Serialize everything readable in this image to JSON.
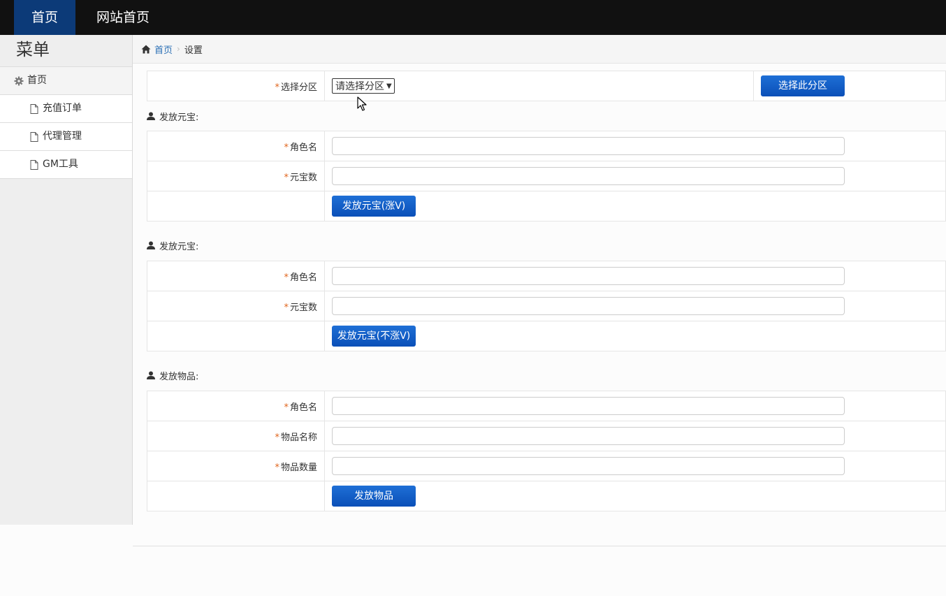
{
  "topnav": {
    "home": "首页",
    "site_home": "网站首页"
  },
  "sidebar": {
    "title": "菜单",
    "home": "首页",
    "items": [
      {
        "label": "充值订单"
      },
      {
        "label": "代理管理"
      },
      {
        "label": "GM工具"
      }
    ]
  },
  "breadcrumb": {
    "home": "首页",
    "current": "设置"
  },
  "zone": {
    "label": "选择分区",
    "select_value": "请选择分区",
    "button": "选择此分区"
  },
  "section1": {
    "title": "发放元宝:",
    "role_label": "角色名",
    "amount_label": "元宝数",
    "button": "发放元宝(涨V)"
  },
  "section2": {
    "title": "发放元宝:",
    "role_label": "角色名",
    "amount_label": "元宝数",
    "button": "发放元宝(不涨V)"
  },
  "section3": {
    "title": "发放物品:",
    "role_label": "角色名",
    "item_name_label": "物品名称",
    "item_qty_label": "物品数量",
    "button": "发放物品"
  },
  "required_mark": "*",
  "colors": {
    "topbar": "#111111",
    "nav_active": "#0c3a78",
    "button": "#0a5cc8",
    "required": "#e0651d",
    "link": "#2a6fb5"
  }
}
